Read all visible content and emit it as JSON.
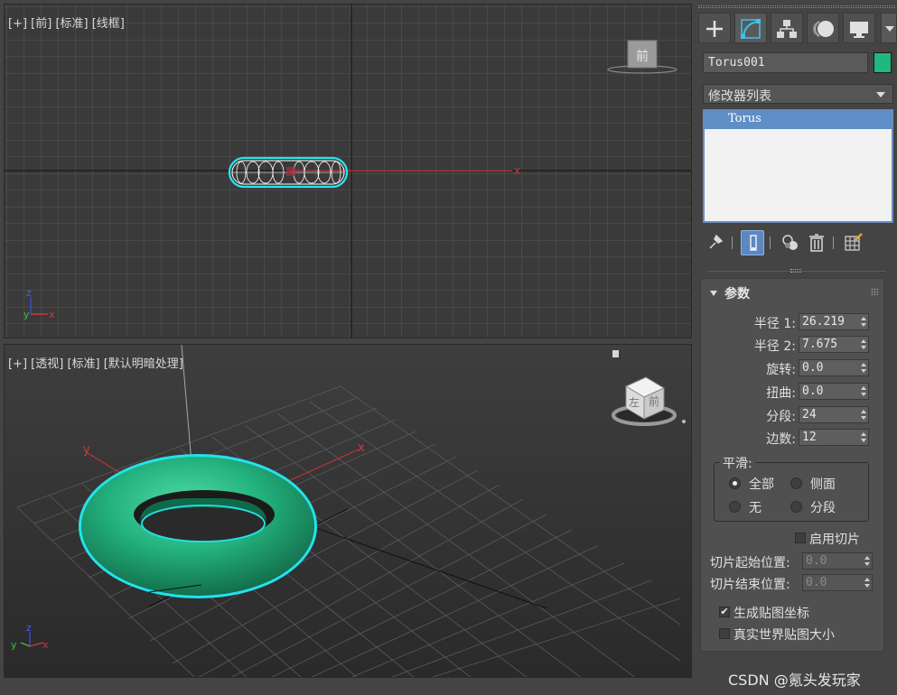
{
  "viewports": {
    "front": {
      "label": "[+] [前] [标准] [线框]",
      "axis_x": "x",
      "gizmo_label": "前"
    },
    "perspective": {
      "label": "[+] [透视] [标准] [默认明暗处理]",
      "axis_x": "x",
      "axis_y": "y",
      "gizmo_label_front": "前",
      "gizmo_label_left": "左"
    },
    "triad": {
      "x": "x",
      "y": "y",
      "z": "z"
    }
  },
  "panel": {
    "tabs": [
      {
        "name": "create",
        "icon": "plus-icon"
      },
      {
        "name": "modify",
        "icon": "modify-curve-icon",
        "active": true
      },
      {
        "name": "hierarchy",
        "icon": "hierarchy-icon"
      },
      {
        "name": "motion",
        "icon": "motion-icon"
      },
      {
        "name": "display",
        "icon": "display-monitor-icon"
      }
    ],
    "object_name": "Torus001",
    "object_color": "#1fb87e",
    "modifier_list": "修改器列表",
    "stack": [
      "Torus"
    ],
    "stack_tools": [
      "pin-stack-icon",
      "show-end-result-icon",
      "make-unique-icon",
      "remove-modifier-icon",
      "configure-modifier-sets-icon"
    ]
  },
  "params": {
    "title": "参数",
    "radius1_label": "半径 1:",
    "radius1": "26.219",
    "radius2_label": "半径 2:",
    "radius2": "7.675",
    "rotation_label": "旋转:",
    "rotation": "0.0",
    "twist_label": "扭曲:",
    "twist": "0.0",
    "segments_label": "分段:",
    "segments": "24",
    "sides_label": "边数:",
    "sides": "12",
    "smooth": {
      "title": "平滑:",
      "all": "全部",
      "sides": "侧面",
      "none": "无",
      "segment": "分段",
      "selected": "all"
    },
    "slice_on_label": "启用切片",
    "slice_from_label": "切片起始位置:",
    "slice_from": "0.0",
    "slice_to_label": "切片结束位置:",
    "slice_to": "0.0",
    "gen_mapping_label": "生成贴图坐标",
    "gen_mapping": true,
    "real_world_label": "真实世界贴图大小",
    "real_world": false
  },
  "watermark": "CSDN @氪头发玩家"
}
